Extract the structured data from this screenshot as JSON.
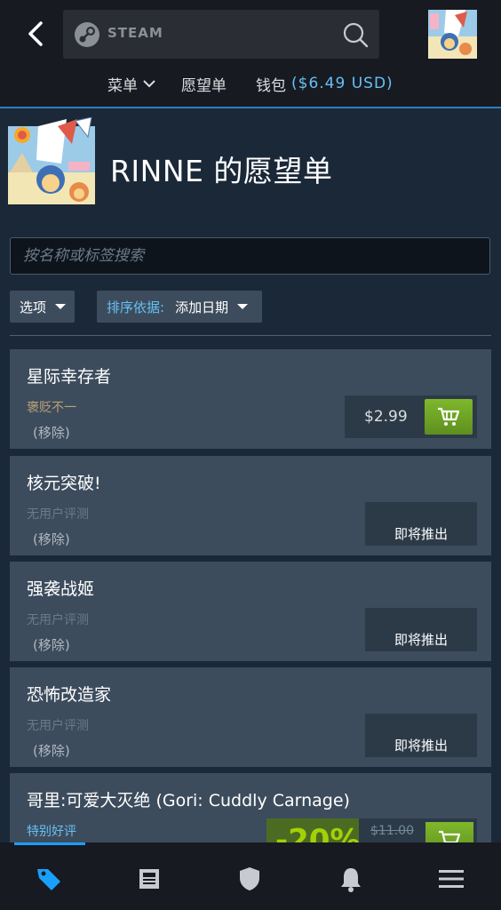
{
  "header": {
    "brand": "STEAM",
    "nav": {
      "menu": "菜单",
      "wishlist": "愿望单",
      "wallet_label": "钱包",
      "wallet_amount": "($6.49 USD)"
    }
  },
  "profile": {
    "title": "RINNE 的愿望单"
  },
  "filters": {
    "search_placeholder": "按名称或标签搜索",
    "options_label": "选项",
    "sort_label": "排序依据:",
    "sort_value": "添加日期"
  },
  "games": [
    {
      "name": "星际幸存者",
      "review": "褒贬不一",
      "review_color": "#b9a074",
      "remove": "(移除)",
      "price": "$2.99"
    },
    {
      "name": "核元突破!",
      "review": "无用户评测",
      "review_color": "#6b7a8a",
      "remove": "(移除)",
      "status": "即将推出"
    },
    {
      "name": "强袭战姬",
      "review": "无用户评测",
      "review_color": "#6b7a8a",
      "remove": "(移除)",
      "status": "即将推出"
    },
    {
      "name": "恐怖改造家",
      "review": "无用户评测",
      "review_color": "#6b7a8a",
      "remove": "(移除)",
      "status": "即将推出"
    },
    {
      "name": "哥里:可爱大灭绝 (Gori: Cuddly Carnage)",
      "review": "特别好评",
      "review_color": "#66c0f4",
      "discount": "-20%",
      "original_price": "$11.00"
    }
  ],
  "bottom_nav": {
    "items": [
      "tag-icon",
      "news-icon",
      "shield-icon",
      "bell-icon",
      "menu-icon"
    ]
  },
  "colors": {
    "accent": "#66c0f4",
    "cart_green": "#6ba12a",
    "background": "#1b2838"
  }
}
